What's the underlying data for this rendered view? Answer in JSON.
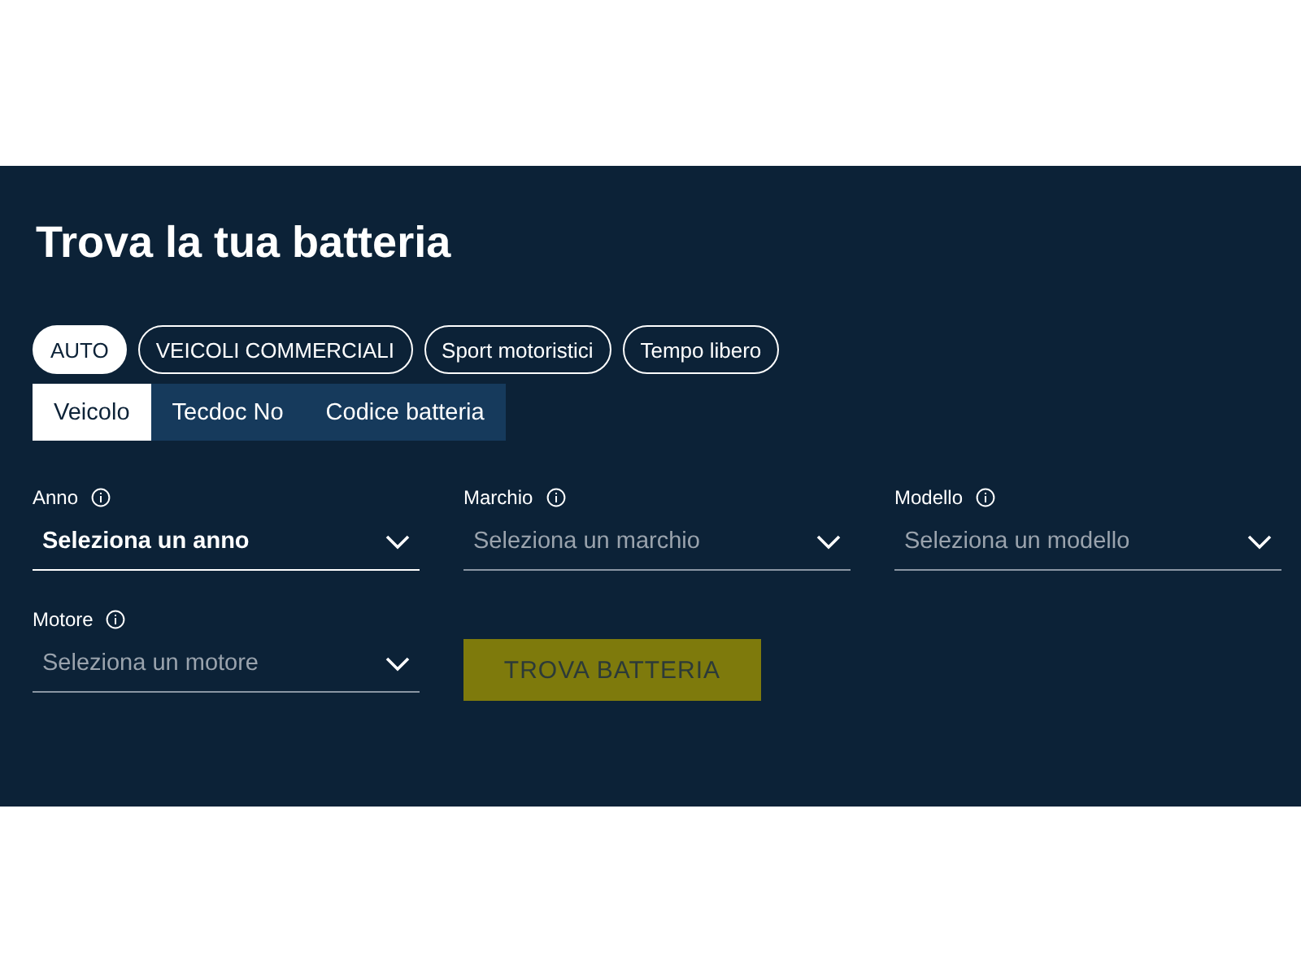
{
  "title": "Trova la tua batteria",
  "categories": [
    {
      "label": "AUTO",
      "selected": true
    },
    {
      "label": "VEICOLI COMMERCIALI",
      "selected": false
    },
    {
      "label": "Sport motoristici",
      "selected": false
    },
    {
      "label": "Tempo libero",
      "selected": false
    }
  ],
  "tabs": [
    {
      "label": "Veicolo",
      "selected": true
    },
    {
      "label": "Tecdoc No",
      "selected": false
    },
    {
      "label": "Codice batteria",
      "selected": false
    }
  ],
  "fields": [
    {
      "label": "Anno",
      "placeholder": "Seleziona un anno",
      "disabled": false
    },
    {
      "label": "Marchio",
      "placeholder": "Seleziona un marchio",
      "disabled": true
    },
    {
      "label": "Modello",
      "placeholder": "Seleziona un modello",
      "disabled": true
    },
    {
      "label": "Motore",
      "placeholder": "Seleziona un motore",
      "disabled": true
    }
  ],
  "button": {
    "label": "TROVA BATTERIA",
    "disabled": true
  }
}
